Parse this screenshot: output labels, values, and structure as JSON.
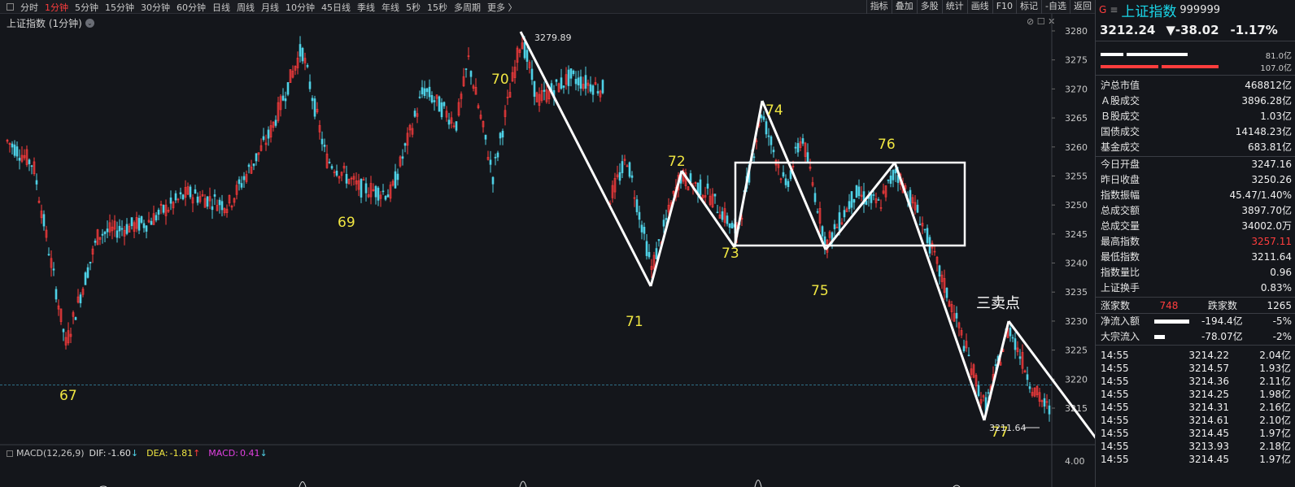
{
  "toolbar": {
    "left_items": [
      "分时",
      "1分钟",
      "5分钟",
      "15分钟",
      "30分钟",
      "60分钟",
      "日线",
      "周线",
      "月线",
      "10分钟",
      "45日线",
      "季线",
      "年线",
      "5秒",
      "15秒",
      "多周期",
      "更多 〉"
    ],
    "active_item": "1分钟",
    "right_items": [
      "指标",
      "叠加",
      "多股",
      "统计",
      "画线",
      "F10",
      "标记",
      "-自选",
      "返回"
    ]
  },
  "chart_header": {
    "title": "上证指数 (1分钟)",
    "dropdown_icon": "chevron-down-icon"
  },
  "window_icons": "⊘ ☐ ✕",
  "price_axis_ticks": [
    "3280",
    "3275",
    "3270",
    "3265",
    "3260",
    "3255",
    "3250",
    "3245",
    "3240",
    "3235",
    "3230",
    "3225",
    "3220",
    "3215"
  ],
  "high_label": "3279.89",
  "low_label": "3211.64",
  "wave_labels": [
    "67",
    "69",
    "70",
    "71",
    "72",
    "73",
    "74",
    "75",
    "76",
    "77"
  ],
  "sell_point_label": "三卖点",
  "macd": {
    "name": "MACD(12,26,9)",
    "dif_label": "DIF:",
    "dif_value": "-1.60",
    "dif_arrow": "↓",
    "dea_label": "DEA:",
    "dea_value": "-1.81",
    "dea_arrow": "↑",
    "macd_label": "MACD:",
    "macd_value": "0.41",
    "macd_arrow": "↓",
    "axis_tick": "4.00"
  },
  "colors": {
    "up": "#ff3d3d",
    "down": "#4fd1e6",
    "accent_yellow": "#f0e642",
    "quote_cyan": "#1ad6e8",
    "bg": "#14161b"
  },
  "quote": {
    "g_badge": "G",
    "menu_icon": "≡",
    "name": "上证指数",
    "code": "999999",
    "price": "3212.24",
    "change": "▼-38.02",
    "change_pct": "-1.17%",
    "bar_top_value": "81.0亿",
    "bar_bottom_value": "107.0亿"
  },
  "stats_group1": [
    {
      "label": "沪总市值",
      "value": "468812亿"
    },
    {
      "label": "Ａ股成交",
      "value": "3896.28亿"
    },
    {
      "label": "Ｂ股成交",
      "value": "1.03亿"
    },
    {
      "label": "国债成交",
      "value": "14148.23亿"
    },
    {
      "label": "基金成交",
      "value": "683.81亿"
    }
  ],
  "stats_group2": [
    {
      "label": "今日开盘",
      "value": "3247.16"
    },
    {
      "label": "昨日收盘",
      "value": "3250.26"
    },
    {
      "label": "指数振幅",
      "value": "45.47/1.40%"
    },
    {
      "label": "总成交额",
      "value": "3897.70亿"
    },
    {
      "label": "总成交量",
      "value": "34002.0万"
    },
    {
      "label": "最高指数",
      "value": "3257.11"
    },
    {
      "label": "最低指数",
      "value": "3211.64"
    },
    {
      "label": "指数量比",
      "value": "0.96"
    },
    {
      "label": "上证换手",
      "value": "0.83%"
    }
  ],
  "breadth": {
    "up_label": "涨家数",
    "up_value": "748",
    "down_label": "跌家数",
    "down_value": "1265"
  },
  "flows": [
    {
      "label": "净流入额",
      "value": "-194.4亿",
      "pct": "-5%",
      "bar": 0.85
    },
    {
      "label": "大宗流入",
      "value": "-78.07亿",
      "pct": "-2%",
      "bar": 0.25
    }
  ],
  "ticks": [
    {
      "time": "14:55",
      "price": "3214.22",
      "vol": "2.04亿"
    },
    {
      "time": "14:55",
      "price": "3214.57",
      "vol": "1.93亿"
    },
    {
      "time": "14:55",
      "price": "3214.36",
      "vol": "2.11亿"
    },
    {
      "time": "14:55",
      "price": "3214.25",
      "vol": "1.98亿"
    },
    {
      "time": "14:55",
      "price": "3214.31",
      "vol": "2.16亿"
    },
    {
      "time": "14:55",
      "price": "3214.61",
      "vol": "2.10亿"
    },
    {
      "time": "14:55",
      "price": "3214.45",
      "vol": "1.97亿"
    },
    {
      "time": "14:55",
      "price": "3213.93",
      "vol": "2.18亿"
    },
    {
      "time": "14:55",
      "price": "3214.45",
      "vol": "1.97亿"
    }
  ]
}
